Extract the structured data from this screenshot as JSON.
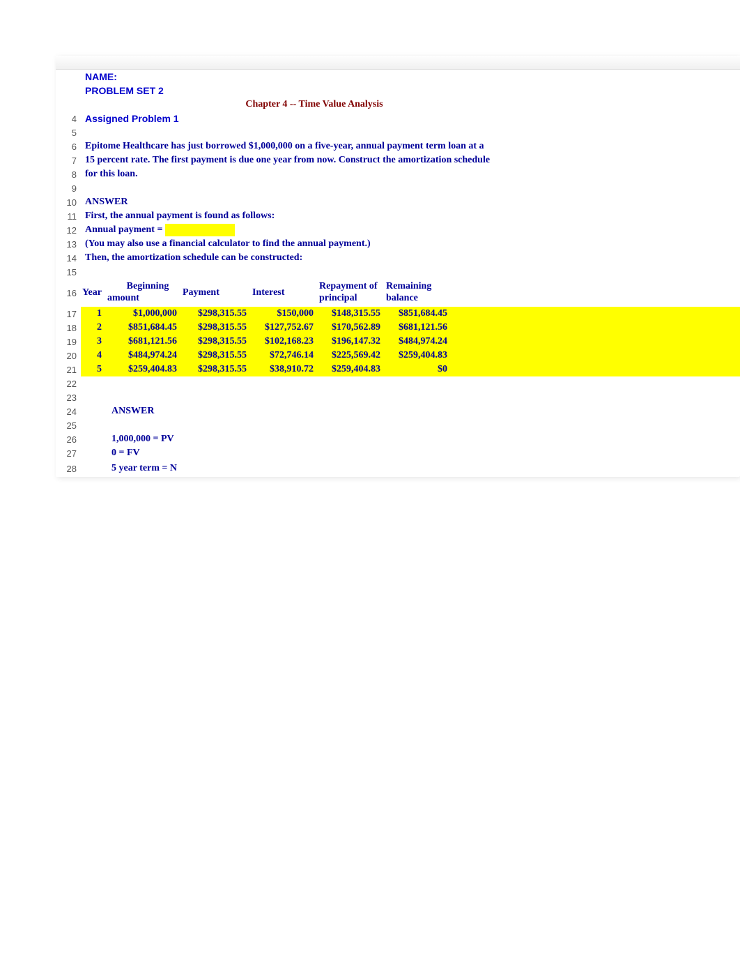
{
  "header": {
    "name_label": "NAME:",
    "problem_set": "PROBLEM SET 2",
    "chapter_title": "Chapter 4 -- Time Value Analysis",
    "assigned": "Assigned Problem 1"
  },
  "problem_text": {
    "line1": "Epitome Healthcare has just borrowed $1,000,000 on a five-year, annual payment term loan at a",
    "line2": "15 percent rate. The first payment is due one year from now. Construct the amortization schedule",
    "line3": "for this loan."
  },
  "answer_section": {
    "heading": "ANSWER",
    "line1": "First, the annual payment is found as follows:",
    "line2": "Annual payment =",
    "line3": "(You may also use a financial calculator to find the annual payment.)",
    "line4": "Then, the amortization schedule can be constructed:"
  },
  "table": {
    "headers": {
      "year": "Year",
      "beginning_top": "Beginning",
      "beginning_bottom": "amount",
      "payment": "Payment",
      "interest": "Interest",
      "repayment_top": "Repayment of",
      "repayment_bottom": "principal",
      "remaining_top": "Remaining",
      "remaining_bottom": "balance"
    },
    "rows": [
      {
        "year": "1",
        "beginning": "$1,000,000",
        "payment": "$298,315.55",
        "interest": "$150,000",
        "repayment": "$148,315.55",
        "remaining": "$851,684.45"
      },
      {
        "year": "2",
        "beginning": "$851,684.45",
        "payment": "$298,315.55",
        "interest": "$127,752.67",
        "repayment": "$170,562.89",
        "remaining": "$681,121.56"
      },
      {
        "year": "3",
        "beginning": "$681,121.56",
        "payment": "$298,315.55",
        "interest": "$102,168.23",
        "repayment": "$196,147.32",
        "remaining": "$484,974.24"
      },
      {
        "year": "4",
        "beginning": "$484,974.24",
        "payment": "$298,315.55",
        "interest": "$72,746.14",
        "repayment": "$225,569.42",
        "remaining": "$259,404.83"
      },
      {
        "year": "5",
        "beginning": "$259,404.83",
        "payment": "$298,315.55",
        "interest": "$38,910.72",
        "repayment": "$259,404.83",
        "remaining": "$0"
      }
    ]
  },
  "answer_block": {
    "heading": "ANSWER",
    "line1": "1,000,000 = PV",
    "line2": "0 = FV",
    "line3": "5 year term = N"
  },
  "row_numbers": [
    "4",
    "5",
    "6",
    "7",
    "8",
    "9",
    "10",
    "11",
    "12",
    "13",
    "14",
    "15",
    "16",
    "17",
    "18",
    "19",
    "20",
    "21",
    "22",
    "23",
    "24",
    "25",
    "26",
    "27",
    "28"
  ]
}
